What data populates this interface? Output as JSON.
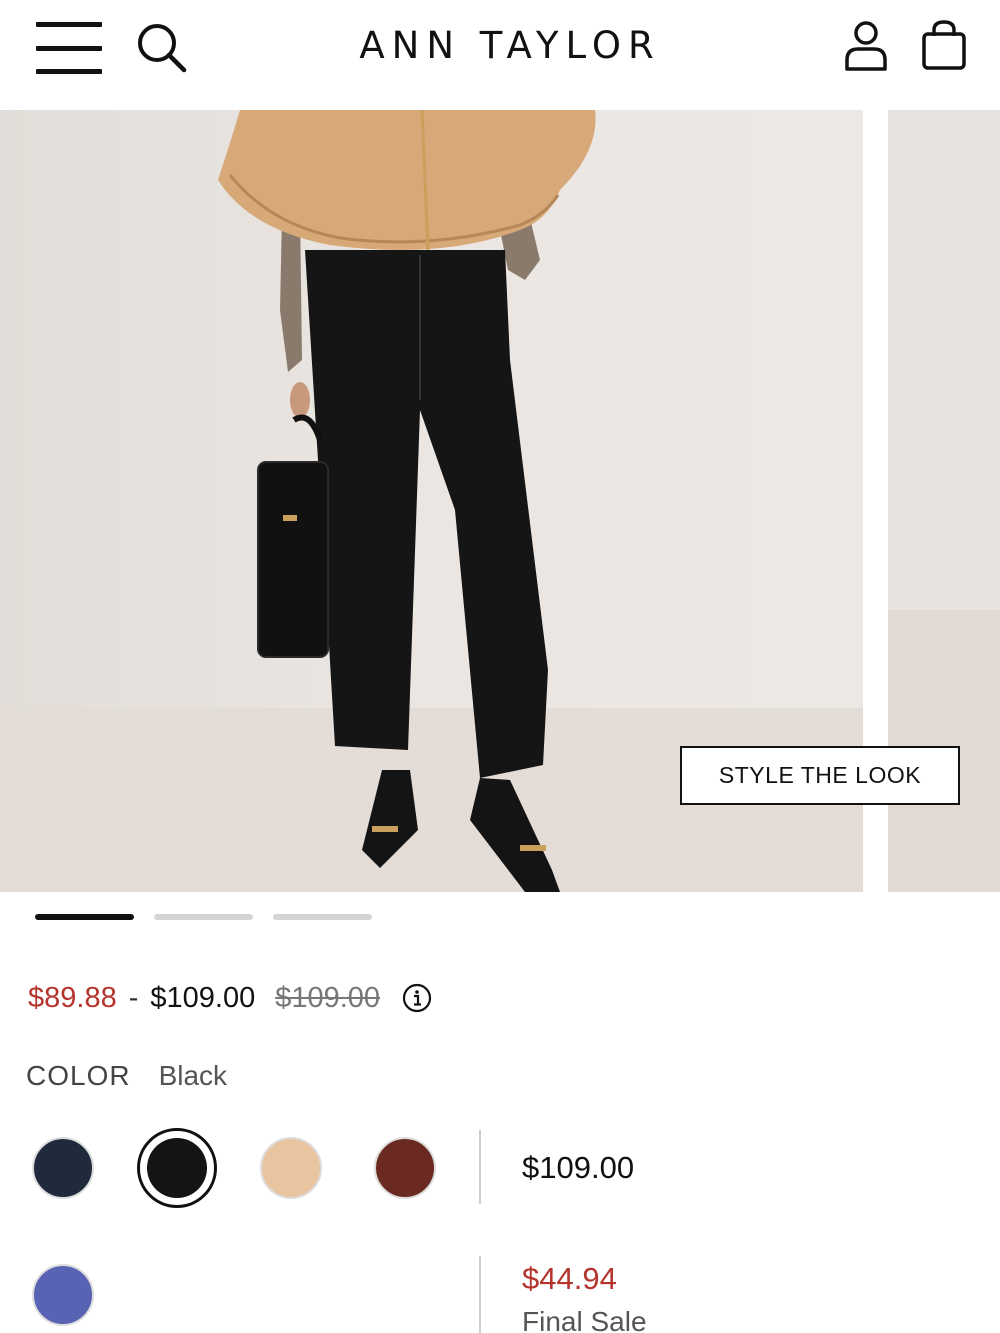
{
  "header": {
    "brand": "ANN TAYLOR"
  },
  "carousel": {
    "style_button_label": "STYLE THE LOOK",
    "pages": 3,
    "active_page": 1
  },
  "price": {
    "sale_low": "$89.88",
    "separator": "-",
    "high": "$109.00",
    "original": "$109.00"
  },
  "color": {
    "label": "COLOR",
    "selected": "Black",
    "swatches": [
      {
        "name": "navy",
        "hex": "#1f2a3d"
      },
      {
        "name": "black",
        "hex": "#141414",
        "selected": true
      },
      {
        "name": "tan",
        "hex": "#e8c4a0"
      },
      {
        "name": "brown",
        "hex": "#6a2a22"
      },
      {
        "name": "blue",
        "hex": "#5863b3"
      }
    ]
  },
  "variant_prices": [
    {
      "price": "$109.00"
    },
    {
      "price": "$44.94",
      "note": "Final Sale"
    }
  ],
  "colors": {
    "sale": "#b5352e",
    "text": "#111111"
  }
}
